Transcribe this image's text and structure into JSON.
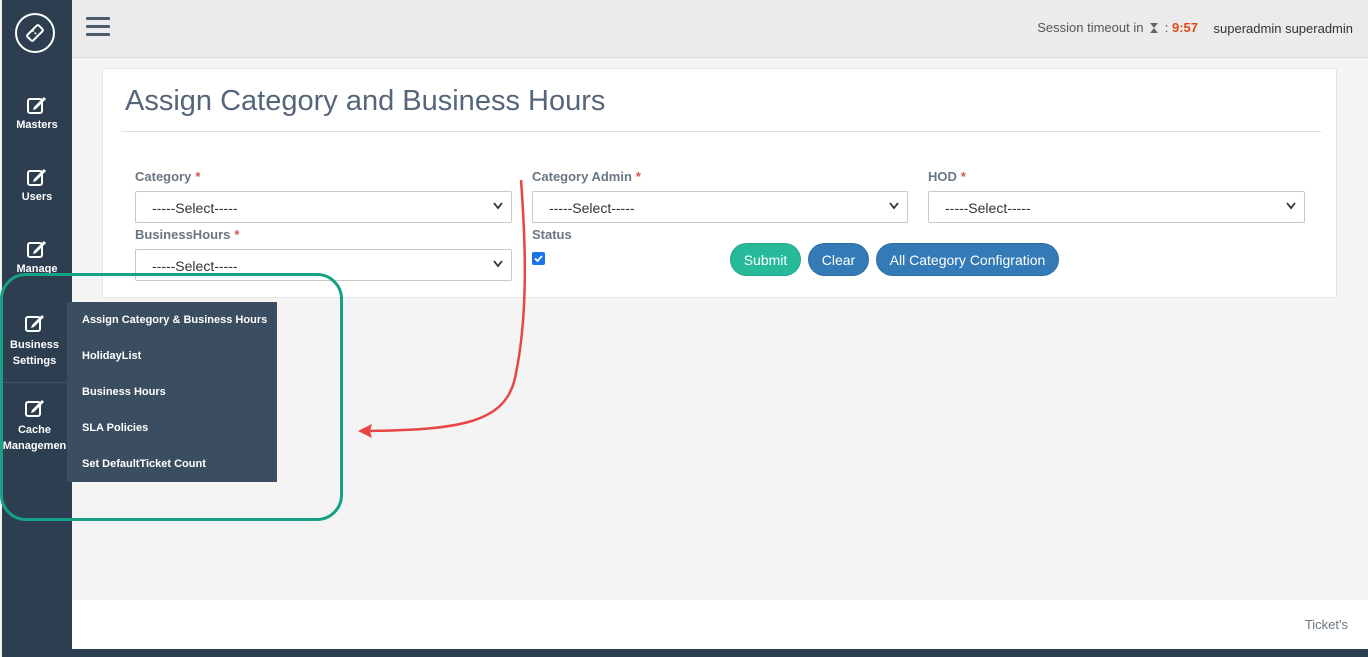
{
  "sidebar": {
    "items": [
      {
        "label": "Masters",
        "icon": "edit-icon"
      },
      {
        "label": "Users",
        "icon": "edit-icon"
      },
      {
        "label": "Manage",
        "icon": "edit-icon"
      },
      {
        "label_line1": "Business",
        "label_line2": "Settings",
        "icon": "edit-icon"
      },
      {
        "label_line1": "Cache",
        "label_line2": "Managemen",
        "icon": "edit-icon"
      }
    ]
  },
  "header": {
    "session_label": "Session timeout in",
    "session_sep": ":",
    "session_time": "9:57",
    "user": "superadmin superadmin"
  },
  "main": {
    "title": "Assign Category and Business Hours",
    "fields": {
      "category": {
        "label": "Category",
        "required": "*",
        "value": "-----Select-----"
      },
      "category_admin": {
        "label": "Category Admin",
        "required": "*",
        "value": "-----Select-----"
      },
      "hod": {
        "label": "HOD",
        "required": "*",
        "value": "-----Select-----"
      },
      "business_hours": {
        "label": "BusinessHours",
        "required": "*",
        "value": "-----Select-----"
      },
      "status": {
        "label": "Status",
        "checked": true
      }
    },
    "buttons": {
      "submit": "Submit",
      "clear": "Clear",
      "all": "All Category Configration"
    }
  },
  "submenu": {
    "items": [
      "Assign Category & Business Hours",
      "HolidayList",
      "Business Hours",
      "SLA Policies",
      "Set DefaultTicket Count"
    ]
  },
  "footer": {
    "text": "Ticket's"
  },
  "colors": {
    "sidebar": "#2c3e50",
    "accent_green": "#26b99a",
    "accent_blue": "#337ab7",
    "timeout": "#e0481b",
    "annotation_arrow": "#e84545",
    "annotation_box": "#16a085"
  }
}
